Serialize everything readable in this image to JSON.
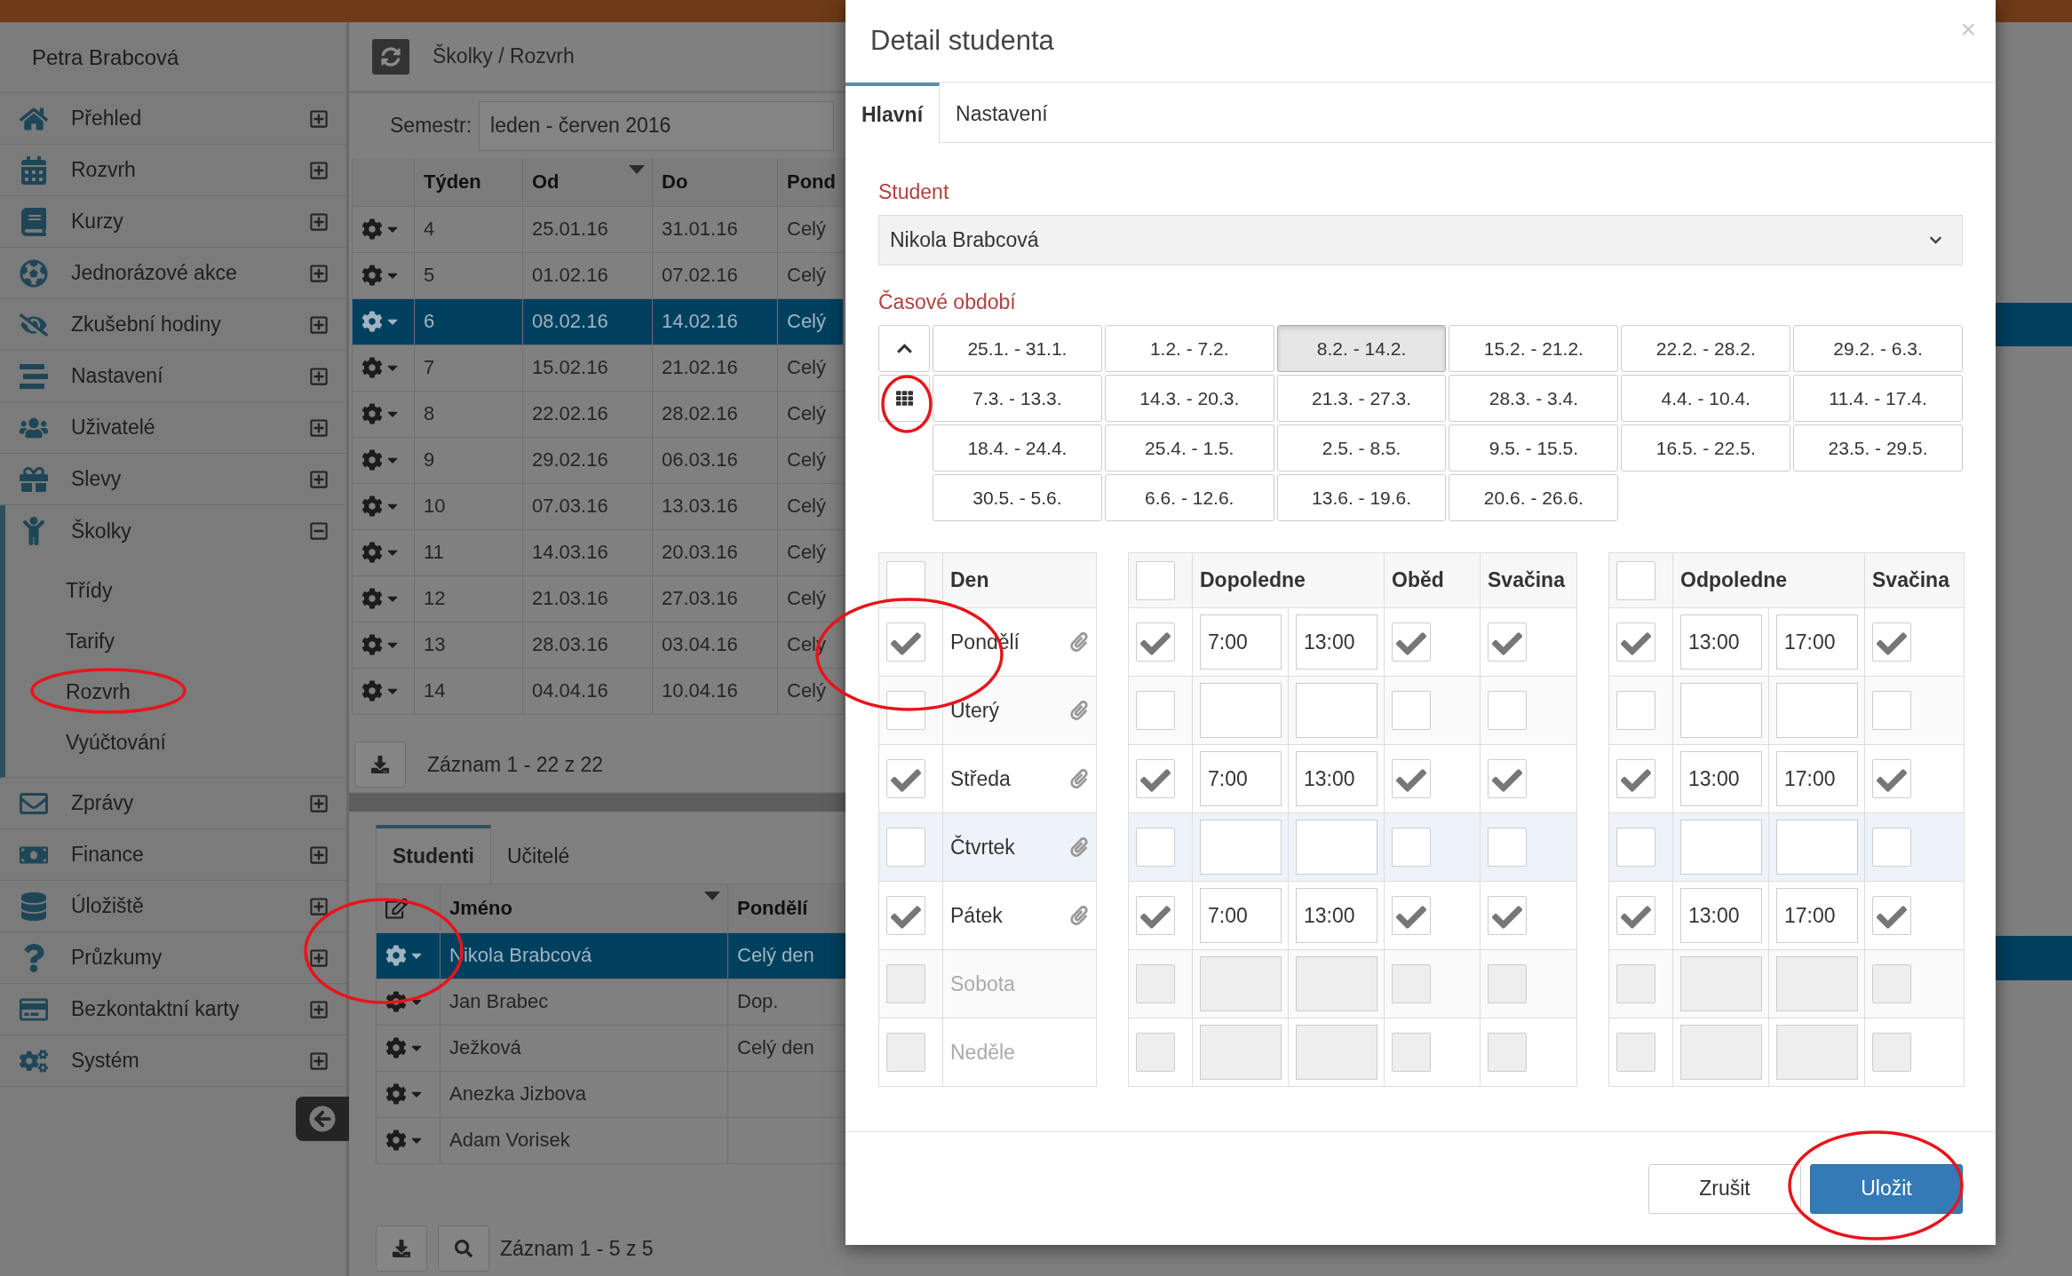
{
  "user": {
    "name": "Petra Brabcová"
  },
  "sidebar": {
    "items": [
      {
        "label": "Přehled",
        "selected": false,
        "expanded": false
      },
      {
        "label": "Rozvrh",
        "selected": false,
        "expanded": false
      },
      {
        "label": "Kurzy",
        "selected": false,
        "expanded": false
      },
      {
        "label": "Jednorázové akce",
        "selected": false,
        "expanded": false
      },
      {
        "label": "Zkušební hodiny",
        "selected": false,
        "expanded": false
      },
      {
        "label": "Nastavení",
        "selected": false,
        "expanded": false
      },
      {
        "label": "Uživatelé",
        "selected": false,
        "expanded": false
      },
      {
        "label": "Slevy",
        "selected": false,
        "expanded": false
      },
      {
        "label": "Školky",
        "selected": true,
        "expanded": true,
        "children": [
          {
            "label": "Třídy"
          },
          {
            "label": "Tarify"
          },
          {
            "label": "Rozvrh"
          },
          {
            "label": "Vyúčtování"
          }
        ]
      },
      {
        "label": "Zprávy",
        "selected": false,
        "expanded": false
      },
      {
        "label": "Finance",
        "selected": false,
        "expanded": false
      },
      {
        "label": "Úložiště",
        "selected": false,
        "expanded": false
      },
      {
        "label": "Průzkumy",
        "selected": false,
        "expanded": false
      },
      {
        "label": "Bezkontaktní karty",
        "selected": false,
        "expanded": false
      },
      {
        "label": "Systém",
        "selected": false,
        "expanded": false
      }
    ]
  },
  "breadcrumb": "Školky / Rozvrh",
  "semester": {
    "label": "Semestr:",
    "value": "leden - červen 2016"
  },
  "weeks_table": {
    "columns": [
      {
        "label": "Týden",
        "sorted": false
      },
      {
        "label": "Od",
        "sorted": true
      },
      {
        "label": "Do",
        "sorted": false
      },
      {
        "label": "Pond",
        "sorted": false
      }
    ],
    "rows": [
      {
        "cells": [
          "4",
          "25.01.16",
          "31.01.16",
          "Celý"
        ],
        "selected": false
      },
      {
        "cells": [
          "5",
          "01.02.16",
          "07.02.16",
          "Celý"
        ],
        "selected": false
      },
      {
        "cells": [
          "6",
          "08.02.16",
          "14.02.16",
          "Celý"
        ],
        "selected": true
      },
      {
        "cells": [
          "7",
          "15.02.16",
          "21.02.16",
          "Celý"
        ],
        "selected": false
      },
      {
        "cells": [
          "8",
          "22.02.16",
          "28.02.16",
          "Celý"
        ],
        "selected": false
      },
      {
        "cells": [
          "9",
          "29.02.16",
          "06.03.16",
          "Celý"
        ],
        "selected": false
      },
      {
        "cells": [
          "10",
          "07.03.16",
          "13.03.16",
          "Celý"
        ],
        "selected": false
      },
      {
        "cells": [
          "11",
          "14.03.16",
          "20.03.16",
          "Celý"
        ],
        "selected": false
      },
      {
        "cells": [
          "12",
          "21.03.16",
          "27.03.16",
          "Celý"
        ],
        "selected": false
      },
      {
        "cells": [
          "13",
          "28.03.16",
          "03.04.16",
          "Celý"
        ],
        "selected": false
      },
      {
        "cells": [
          "14",
          "04.04.16",
          "10.04.16",
          "Celý"
        ],
        "selected": false
      }
    ],
    "footer": "Záznam 1 - 22 z 22"
  },
  "bottom_panel": {
    "tabs": [
      {
        "label": "Studenti",
        "selected": true
      },
      {
        "label": "Učitelé",
        "selected": false
      }
    ],
    "columns": [
      {
        "label": "Jméno",
        "sorted": true
      },
      {
        "label": "Pondělí",
        "sorted": false
      }
    ],
    "rows": [
      {
        "cells": [
          "Nikola Brabcová",
          "Celý den"
        ],
        "selected": true
      },
      {
        "cells": [
          "Jan Brabec",
          "Dop."
        ],
        "selected": false
      },
      {
        "cells": [
          "Ježková",
          "Celý den"
        ],
        "selected": false
      },
      {
        "cells": [
          "Anezka Jizbova"
        ],
        "selected": false
      },
      {
        "cells": [
          "Adam Vorisek"
        ],
        "selected": false
      }
    ],
    "footer": "Záznam 1 - 5 z 5"
  },
  "modal": {
    "title": "Detail studenta",
    "close": "×",
    "tabs": [
      {
        "label": "Hlavní",
        "selected": true
      },
      {
        "label": "Nastavení",
        "selected": false
      }
    ],
    "student_label": "Student",
    "student_value": "Nikola Brabcová",
    "period_label": "Časové období",
    "periods": [
      {
        "label": "25.1. - 31.1.",
        "selected": false
      },
      {
        "label": "1.2. - 7.2.",
        "selected": false
      },
      {
        "label": "8.2. - 14.2.",
        "selected": true
      },
      {
        "label": "15.2. - 21.2.",
        "selected": false
      },
      {
        "label": "22.2. - 28.2.",
        "selected": false
      },
      {
        "label": "29.2. - 6.3.",
        "selected": false
      },
      {
        "label": "7.3. - 13.3.",
        "selected": false
      },
      {
        "label": "14.3. - 20.3.",
        "selected": false
      },
      {
        "label": "21.3. - 27.3.",
        "selected": false
      },
      {
        "label": "28.3. - 3.4.",
        "selected": false
      },
      {
        "label": "4.4. - 10.4.",
        "selected": false
      },
      {
        "label": "11.4. - 17.4.",
        "selected": false
      },
      {
        "label": "18.4. - 24.4.",
        "selected": false
      },
      {
        "label": "25.4. - 1.5.",
        "selected": false
      },
      {
        "label": "2.5. - 8.5.",
        "selected": false
      },
      {
        "label": "9.5. - 15.5.",
        "selected": false
      },
      {
        "label": "16.5. - 22.5.",
        "selected": false
      },
      {
        "label": "23.5. - 29.5.",
        "selected": false
      },
      {
        "label": "30.5. - 5.6.",
        "selected": false
      },
      {
        "label": "6.6. - 12.6.",
        "selected": false
      },
      {
        "label": "13.6. - 19.6.",
        "selected": false
      },
      {
        "label": "20.6. - 26.6.",
        "selected": false
      }
    ],
    "schedule": {
      "headers": {
        "day": "Den",
        "morning": "Dopoledne",
        "lunch": "Oběd",
        "morning_snack": "Svačina",
        "afternoon": "Odpoledne",
        "afternoon_snack": "Svačina"
      },
      "all_checked": {
        "day": false,
        "morning": false,
        "afternoon": false
      },
      "days": [
        {
          "name": "Pondělí",
          "checked": true,
          "disabled": false,
          "highlighted": false,
          "morning": {
            "checked": true,
            "from": "7:00",
            "to": "13:00",
            "lunch": true,
            "snack": true
          },
          "afternoon": {
            "checked": true,
            "from": "13:00",
            "to": "17:00",
            "snack": true
          }
        },
        {
          "name": "Uterý",
          "checked": false,
          "disabled": false,
          "highlighted": false,
          "morning": {
            "checked": false,
            "lunch": false,
            "snack": false
          },
          "afternoon": {
            "checked": false,
            "snack": false
          }
        },
        {
          "name": "Středa",
          "checked": true,
          "disabled": false,
          "highlighted": false,
          "morning": {
            "checked": true,
            "from": "7:00",
            "to": "13:00",
            "lunch": true,
            "snack": true
          },
          "afternoon": {
            "checked": true,
            "from": "13:00",
            "to": "17:00",
            "snack": true
          }
        },
        {
          "name": "Čtvrtek",
          "checked": false,
          "disabled": false,
          "highlighted": true,
          "morning": {
            "checked": false,
            "lunch": false,
            "snack": false
          },
          "afternoon": {
            "checked": false,
            "snack": false
          }
        },
        {
          "name": "Pátek",
          "checked": true,
          "disabled": false,
          "highlighted": false,
          "morning": {
            "checked": true,
            "from": "7:00",
            "to": "13:00",
            "lunch": true,
            "snack": true
          },
          "afternoon": {
            "checked": true,
            "from": "13:00",
            "to": "17:00",
            "snack": true
          }
        },
        {
          "name": "Sobota",
          "checked": false,
          "disabled": true,
          "highlighted": false,
          "morning": {
            "checked": false,
            "lunch": false,
            "snack": false
          },
          "afternoon": {
            "checked": false,
            "snack": false
          }
        },
        {
          "name": "Neděle",
          "checked": false,
          "disabled": true,
          "highlighted": false,
          "morning": {
            "checked": false,
            "lunch": false,
            "snack": false
          },
          "afternoon": {
            "checked": false,
            "snack": false
          }
        }
      ]
    },
    "buttons": [
      {
        "label": "Zrušit",
        "kind": "default"
      },
      {
        "label": "Uložit",
        "kind": "primary"
      }
    ]
  },
  "annotations": [
    {
      "kind": "ellipse",
      "color": "#e8141c"
    },
    {
      "kind": "ellipse",
      "color": "#e8141c"
    },
    {
      "kind": "ellipse",
      "color": "#e8141c"
    },
    {
      "kind": "ellipse",
      "color": "#e8141c"
    },
    {
      "kind": "ellipse",
      "color": "#e8141c"
    }
  ]
}
